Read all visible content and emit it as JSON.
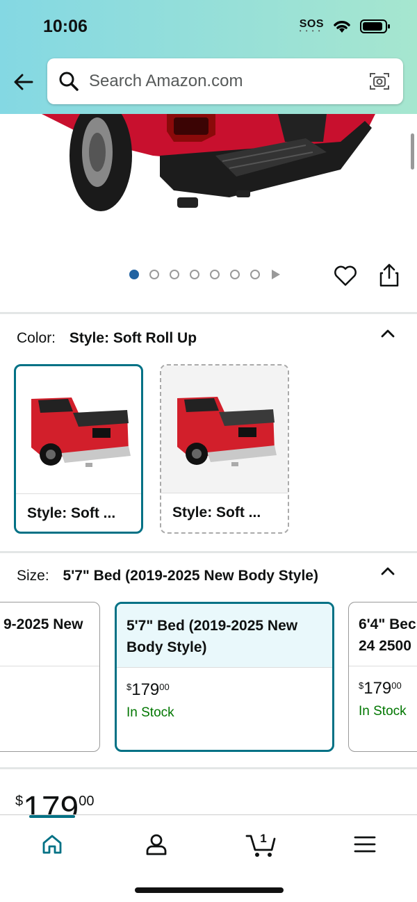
{
  "status_bar": {
    "time": "10:06",
    "sos": "SOS"
  },
  "search": {
    "placeholder": "Search Amazon.com"
  },
  "carousel": {
    "total_dots": 7,
    "active_index": 0
  },
  "color_section": {
    "label": "Color:",
    "value": "Style: Soft Roll Up",
    "options": [
      {
        "caption": "Style: Soft ...",
        "selected": true
      },
      {
        "caption": "Style: Soft ...",
        "selected": false
      }
    ]
  },
  "size_section": {
    "label": "Size:",
    "value": "5'7\" Bed (2019-2025 New Body Style)",
    "options": [
      {
        "title": "9-2025 New",
        "price_whole": "",
        "price_fraction": "",
        "stock": ""
      },
      {
        "title": "5'7\" Bed (2019-2025 New Body Style)",
        "price_symbol": "$",
        "price_whole": "179",
        "price_fraction": "00",
        "stock": "In Stock",
        "selected": true
      },
      {
        "title_line1": "6'4\" Bec",
        "title_line2": "24 2500",
        "price_symbol": "$",
        "price_whole": "179",
        "price_fraction": "00",
        "stock": "In Stock"
      }
    ]
  },
  "main_price": {
    "symbol": "$",
    "whole": "179",
    "fraction": "00"
  },
  "bottom_nav": {
    "cart_count": "1"
  },
  "colors": {
    "accent": "#007185",
    "in_stock": "#007600",
    "dot_active": "#2162a1"
  }
}
